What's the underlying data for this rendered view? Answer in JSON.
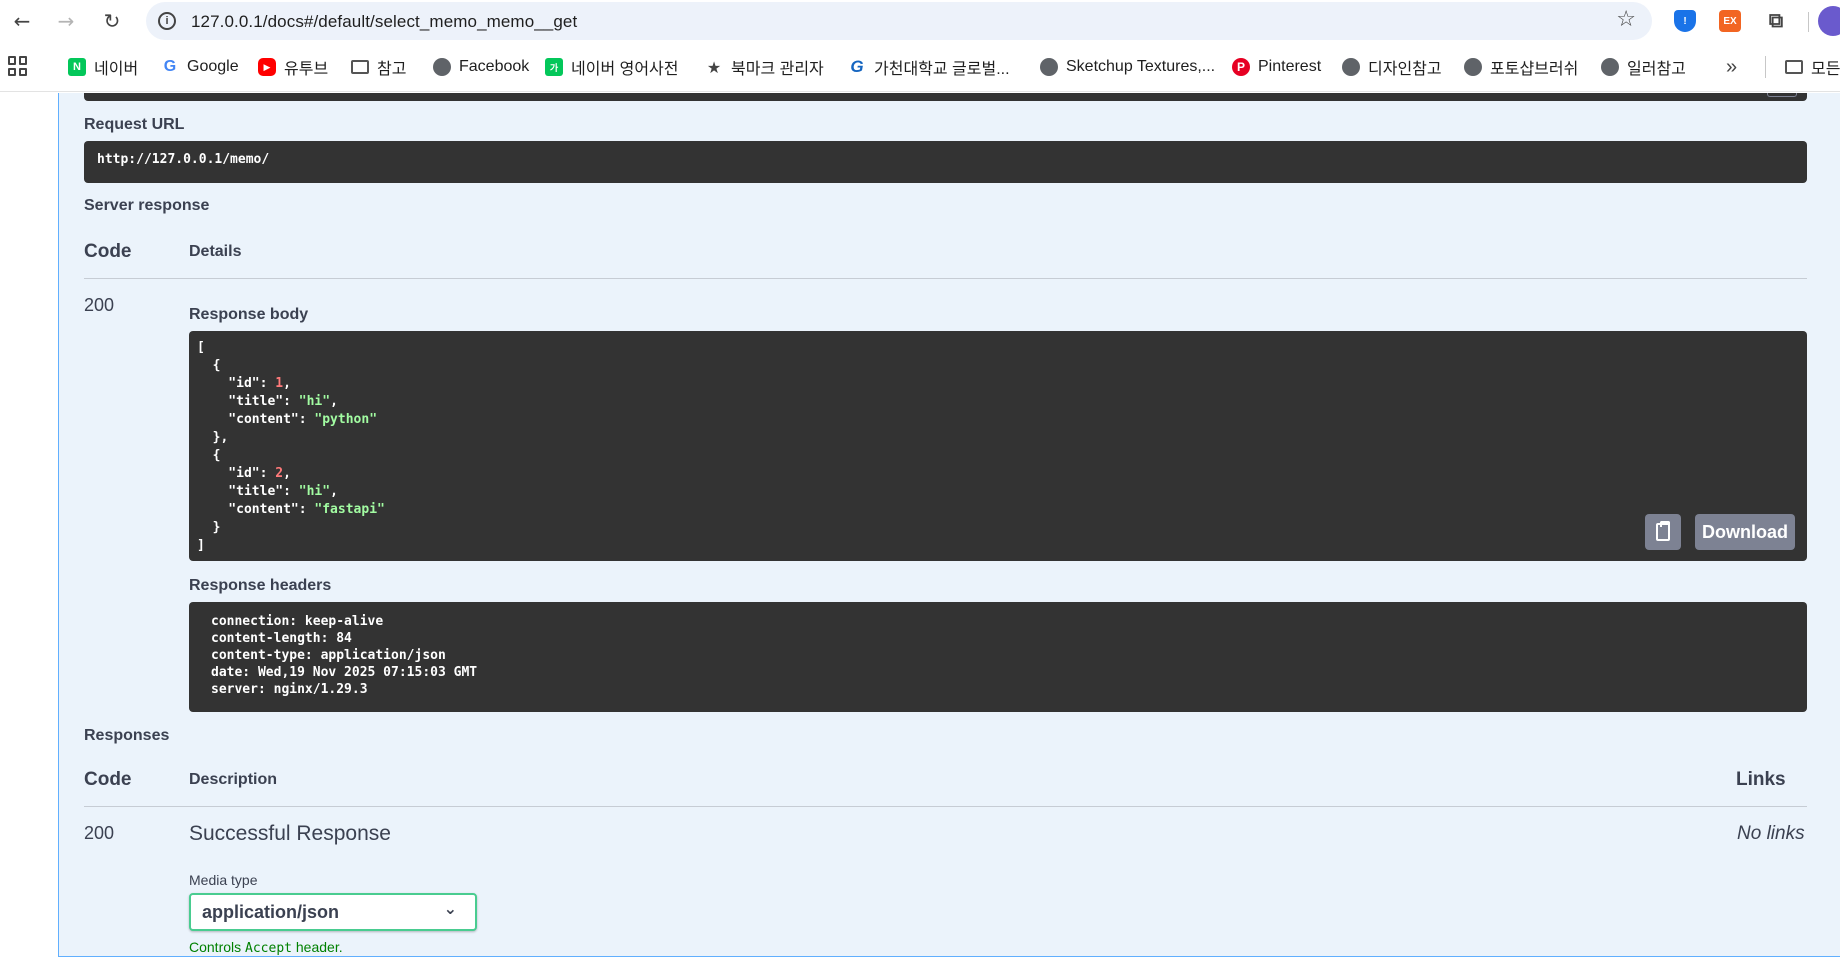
{
  "browser": {
    "url": "127.0.0.1/docs#/default/select_memo_memo__get",
    "nav": {
      "back": "←",
      "forward": "→",
      "reload": "↻"
    },
    "extensions": {
      "ex_label": "EX"
    },
    "bookmarks": [
      {
        "label": "네이버",
        "icon": "naver-icon",
        "glyph": "N"
      },
      {
        "label": "Google",
        "icon": "google-icon",
        "glyph": "G"
      },
      {
        "label": "유투브",
        "icon": "youtube-icon",
        "glyph": "▶"
      },
      {
        "label": "참고",
        "icon": "folder-icon",
        "glyph": ""
      },
      {
        "label": "Facebook",
        "icon": "globe-icon",
        "glyph": ""
      },
      {
        "label": "네이버 영어사전",
        "icon": "dictionary-icon",
        "glyph": "가"
      },
      {
        "label": "북마크 관리자",
        "icon": "star-icon",
        "glyph": "★"
      },
      {
        "label": "가천대학교 글로벌...",
        "icon": "gachon-icon",
        "glyph": "G"
      },
      {
        "label": "Sketchup Textures,...",
        "icon": "globe-icon",
        "glyph": ""
      },
      {
        "label": "Pinterest",
        "icon": "pinterest-icon",
        "glyph": "P"
      },
      {
        "label": "디자인참고",
        "icon": "globe-icon",
        "glyph": ""
      },
      {
        "label": "포토샵브러쉬",
        "icon": "globe-icon",
        "glyph": ""
      },
      {
        "label": "일러참고",
        "icon": "globe-icon",
        "glyph": ""
      }
    ],
    "more": "»",
    "all_bookmarks": "모든"
  },
  "swagger": {
    "request_url_label": "Request URL",
    "request_url": "http://127.0.0.1/memo/",
    "server_response_label": "Server response",
    "code_header": "Code",
    "details_header": "Details",
    "status_code": "200",
    "response_body_label": "Response body",
    "response_body": [
      {
        "id": 1,
        "title": "hi",
        "content": "python"
      },
      {
        "id": 2,
        "title": "hi",
        "content": "fastapi"
      }
    ],
    "download_label": "Download",
    "response_headers_label": "Response headers",
    "response_headers": [
      "connection: keep-alive",
      "content-length: 84",
      "content-type: application/json",
      "date: Wed,19 Nov 2025 07:15:03 GMT",
      "server: nginx/1.29.3"
    ],
    "responses_label": "Responses",
    "responses_code_header": "Code",
    "description_header": "Description",
    "links_header": "Links",
    "response_code": "200",
    "response_description": "Successful Response",
    "response_links": "No links",
    "media_type_label": "Media type",
    "media_type_value": "application/json",
    "controls_hint_prefix": "Controls ",
    "controls_hint_code": "Accept",
    "controls_hint_suffix": " header."
  },
  "colors": {
    "opblock_bg": "#ebf3fb",
    "opblock_border": "#61affe",
    "code_bg": "#333333",
    "media_border": "#49cc90",
    "hint_text": "#008000"
  }
}
